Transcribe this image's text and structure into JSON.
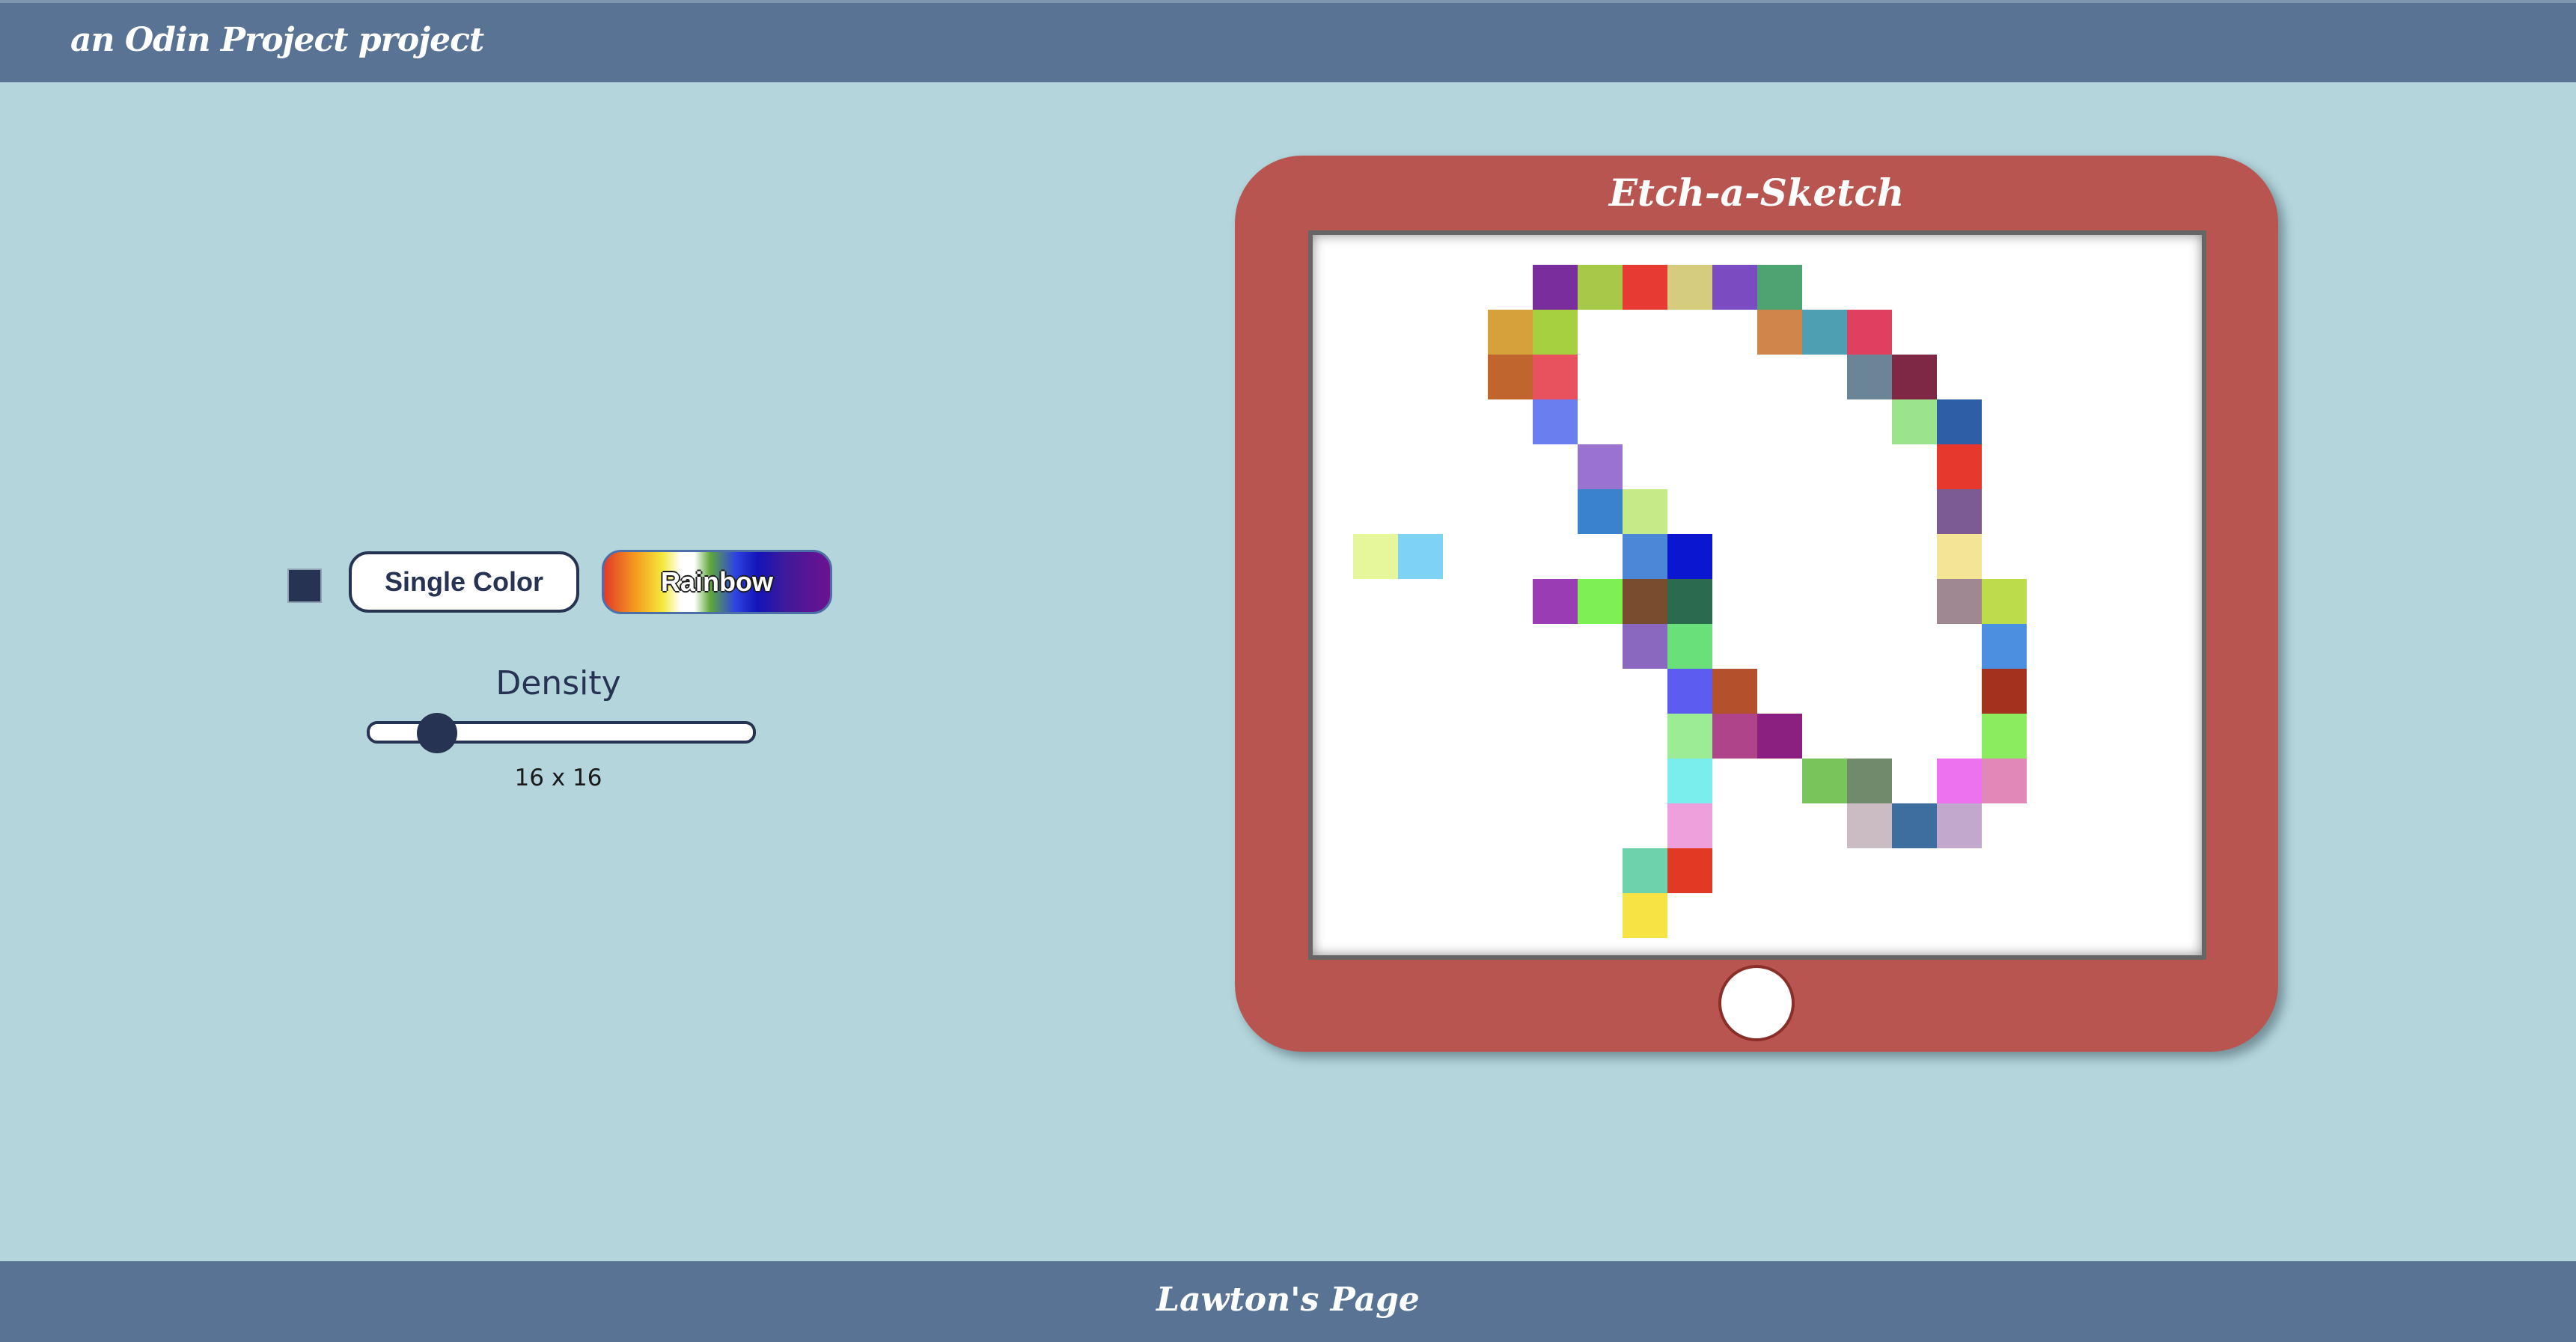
{
  "header": {
    "title": "an Odin Project project"
  },
  "footer": {
    "title": "Lawton's Page"
  },
  "controls": {
    "swatch_color": "#263352",
    "single_color_label": "Single Color",
    "rainbow_label": "Rainbow",
    "density_label": "Density",
    "density_value_text": "16 x 16",
    "density_fraction": 0.18
  },
  "etch": {
    "title": "Etch-a-Sketch",
    "grid_size": 16,
    "cells": [
      {
        "c": 4,
        "r": 0,
        "color": "#7a2e9e"
      },
      {
        "c": 5,
        "r": 0,
        "color": "#a8c84a"
      },
      {
        "c": 6,
        "r": 0,
        "color": "#e63a33"
      },
      {
        "c": 7,
        "r": 0,
        "color": "#d6cc7e"
      },
      {
        "c": 8,
        "r": 0,
        "color": "#7a4cc2"
      },
      {
        "c": 9,
        "r": 0,
        "color": "#4fa372"
      },
      {
        "c": 3,
        "r": 1,
        "color": "#d6a03a"
      },
      {
        "c": 4,
        "r": 1,
        "color": "#a6d040"
      },
      {
        "c": 9,
        "r": 1,
        "color": "#d0864a"
      },
      {
        "c": 10,
        "r": 1,
        "color": "#4f9fb3"
      },
      {
        "c": 11,
        "r": 1,
        "color": "#e03f5f"
      },
      {
        "c": 3,
        "r": 2,
        "color": "#c0652e"
      },
      {
        "c": 4,
        "r": 2,
        "color": "#e8525e"
      },
      {
        "c": 11,
        "r": 2,
        "color": "#6c8596"
      },
      {
        "c": 12,
        "r": 2,
        "color": "#7e2846"
      },
      {
        "c": 4,
        "r": 3,
        "color": "#6a7ef0"
      },
      {
        "c": 12,
        "r": 3,
        "color": "#9ce48c"
      },
      {
        "c": 13,
        "r": 3,
        "color": "#2e5fa6"
      },
      {
        "c": 5,
        "r": 4,
        "color": "#9a72d0"
      },
      {
        "c": 13,
        "r": 4,
        "color": "#e6382c"
      },
      {
        "c": 5,
        "r": 5,
        "color": "#3a82cc"
      },
      {
        "c": 6,
        "r": 5,
        "color": "#c6ea88"
      },
      {
        "c": 13,
        "r": 5,
        "color": "#7c5a92"
      },
      {
        "c": 0,
        "r": 6,
        "color": "#e6f69a"
      },
      {
        "c": 1,
        "r": 6,
        "color": "#7ed2f6"
      },
      {
        "c": 6,
        "r": 6,
        "color": "#4c86d6"
      },
      {
        "c": 7,
        "r": 6,
        "color": "#0a16d0"
      },
      {
        "c": 13,
        "r": 6,
        "color": "#f2e696"
      },
      {
        "c": 4,
        "r": 7,
        "color": "#9a3cb4"
      },
      {
        "c": 5,
        "r": 7,
        "color": "#7ef054"
      },
      {
        "c": 6,
        "r": 7,
        "color": "#7a4c2e"
      },
      {
        "c": 7,
        "r": 7,
        "color": "#2c6a50"
      },
      {
        "c": 13,
        "r": 7,
        "color": "#a08892"
      },
      {
        "c": 14,
        "r": 7,
        "color": "#bcdc4c"
      },
      {
        "c": 6,
        "r": 8,
        "color": "#8a68c0"
      },
      {
        "c": 7,
        "r": 8,
        "color": "#6ae07a"
      },
      {
        "c": 14,
        "r": 8,
        "color": "#4c8ee0"
      },
      {
        "c": 7,
        "r": 9,
        "color": "#5c5cf0"
      },
      {
        "c": 8,
        "r": 9,
        "color": "#b4502c"
      },
      {
        "c": 14,
        "r": 9,
        "color": "#a2321e"
      },
      {
        "c": 7,
        "r": 10,
        "color": "#9cec96"
      },
      {
        "c": 8,
        "r": 10,
        "color": "#b0448a"
      },
      {
        "c": 9,
        "r": 10,
        "color": "#8c2080"
      },
      {
        "c": 14,
        "r": 10,
        "color": "#8aec5e"
      },
      {
        "c": 7,
        "r": 11,
        "color": "#7aeeec"
      },
      {
        "c": 10,
        "r": 11,
        "color": "#7ac45c"
      },
      {
        "c": 11,
        "r": 11,
        "color": "#728a6c"
      },
      {
        "c": 13,
        "r": 11,
        "color": "#ec72f0"
      },
      {
        "c": 14,
        "r": 11,
        "color": "#e288b8"
      },
      {
        "c": 7,
        "r": 12,
        "color": "#eea0dc"
      },
      {
        "c": 11,
        "r": 12,
        "color": "#cabcc2"
      },
      {
        "c": 12,
        "r": 12,
        "color": "#3e6ea0"
      },
      {
        "c": 13,
        "r": 12,
        "color": "#c2a8cc"
      },
      {
        "c": 6,
        "r": 13,
        "color": "#6ed2ac"
      },
      {
        "c": 7,
        "r": 13,
        "color": "#e03a24"
      },
      {
        "c": 6,
        "r": 14,
        "color": "#f6e444"
      }
    ]
  }
}
